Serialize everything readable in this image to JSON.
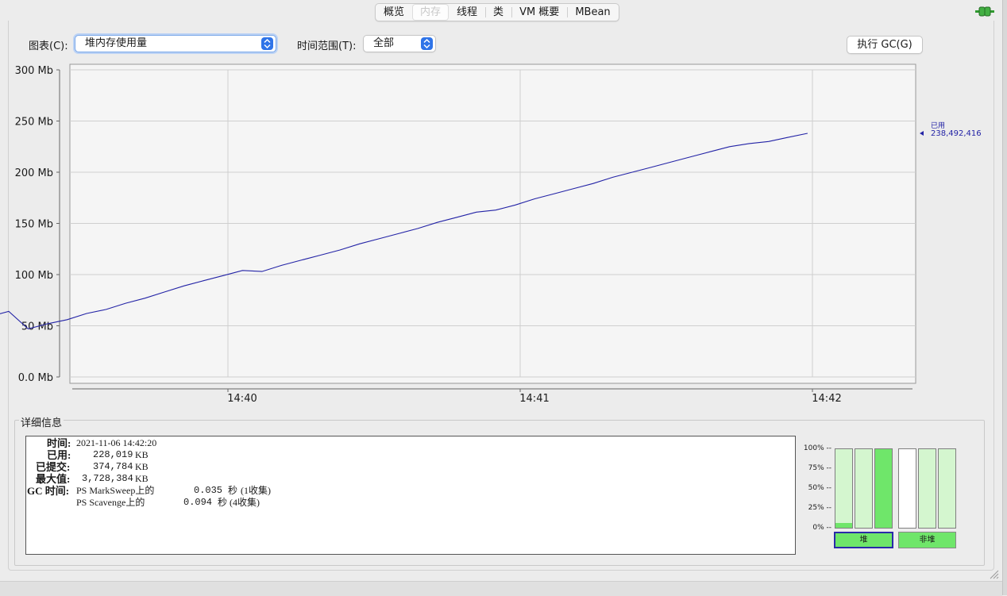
{
  "tabs": [
    {
      "label": "概览",
      "active": false
    },
    {
      "label": "内存",
      "active": true
    },
    {
      "label": "线程",
      "active": false
    },
    {
      "label": "类",
      "active": false
    },
    {
      "label": "VM 概要",
      "active": false
    },
    {
      "label": "MBean",
      "active": false
    }
  ],
  "controls": {
    "chart_label": "图表(C):",
    "chart_value": "堆内存使用量",
    "range_label": "时间范围(T):",
    "range_value": "全部",
    "gc_button": "执行 GC(G)"
  },
  "colors": {
    "line": "#2323a6",
    "fill_green": "#6fe66a",
    "light_green": "#d4f6cf",
    "accent_blue": "#2f74e8"
  },
  "chart_data": {
    "type": "line",
    "x_unit": "time",
    "y_unit": "Mb",
    "xticks": [
      "14:40",
      "14:41",
      "14:42"
    ],
    "ylim": [
      0,
      300
    ],
    "yticks": [
      "0.0 Mb",
      "50 Mb",
      "100 Mb",
      "150 Mb",
      "200 Mb",
      "250 Mb",
      "300 Mb"
    ],
    "grid": true,
    "series": [
      {
        "name": "已用",
        "current_value": "238,492,416",
        "x_seconds_after_1439": [
          3,
          7,
          11,
          15,
          19,
          23,
          27,
          31,
          35,
          39,
          43,
          47,
          51,
          55,
          59,
          63,
          67,
          71,
          75,
          79,
          83,
          87,
          91,
          95,
          99,
          103,
          107,
          111,
          115,
          119,
          123,
          127,
          131,
          135,
          139,
          143,
          147,
          151,
          155,
          159,
          163,
          167,
          171,
          175,
          179
        ],
        "values_mb": [
          49,
          55,
          59,
          64,
          47,
          52,
          56,
          62,
          66,
          72,
          77,
          83,
          89,
          94,
          99,
          104,
          103,
          109,
          114,
          119,
          124,
          130,
          135,
          140,
          145,
          151,
          156,
          161,
          163,
          168,
          174,
          179,
          184,
          189,
          195,
          200,
          205,
          210,
          215,
          220,
          225,
          228,
          230,
          234,
          238
        ]
      }
    ]
  },
  "details": {
    "title": "详细信息",
    "time_label": "时间:",
    "time_value": "2021-11-06 14:42:20",
    "used_label": "已用:",
    "used_value": "228,019",
    "committed_label": "已提交:",
    "committed_value": "374,784",
    "max_label": "最大值:",
    "max_value": "3,728,384",
    "unit": "KB",
    "gc_label": "GC 时间:",
    "gc_rows": [
      {
        "name": "PS MarkSweep上的",
        "time": "0.035",
        "unit": "秒",
        "count": "(1收集)"
      },
      {
        "name": "PS Scavenge上的",
        "time": "0.094",
        "unit": "秒",
        "count": "(4收集)"
      }
    ]
  },
  "bars": {
    "pct_labels": [
      "100% --",
      "75% --",
      "50% --",
      "25% --",
      "0% --"
    ],
    "heap_fills": [
      0.06,
      0,
      1.0
    ],
    "heap_label": "堆",
    "nonheap_label": "非堆"
  }
}
